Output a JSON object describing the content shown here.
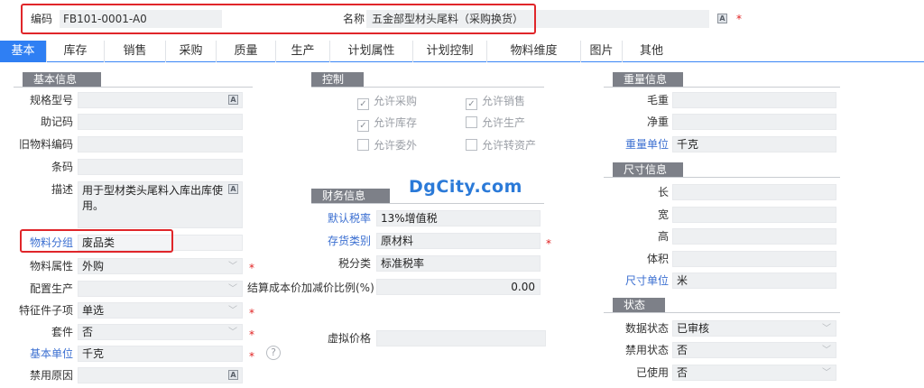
{
  "header": {
    "code_label": "编码",
    "code_value": "FB101-0001-A0",
    "name_label": "名称",
    "name_value": "五金部型材头尾料（采购换货）"
  },
  "tabs": [
    "基本",
    "库存",
    "销售",
    "采购",
    "质量",
    "生产",
    "计划属性",
    "计划控制",
    "物料维度",
    "图片",
    "其他"
  ],
  "basic": {
    "section_title": "基本信息",
    "spec_label": "规格型号",
    "mnemonic_label": "助记码",
    "old_code_label": "旧物料编码",
    "barcode_label": "条码",
    "desc_label": "描述",
    "desc_value": "用于型材类头尾料入库出库使用。",
    "group_label": "物料分组",
    "group_value": "废品类",
    "attr_label": "物料属性",
    "attr_value": "外购",
    "config_label": "配置生产",
    "feature_label": "特征件子项",
    "feature_value": "单选",
    "kit_label": "套件",
    "kit_value": "否",
    "unit_label": "基本单位",
    "unit_value": "千克",
    "disable_reason_label": "禁用原因"
  },
  "control": {
    "section_title": "控制",
    "items": [
      {
        "label": "允许采购",
        "checked": true
      },
      {
        "label": "允许销售",
        "checked": true
      },
      {
        "label": "允许库存",
        "checked": true
      },
      {
        "label": "允许生产",
        "checked": false
      },
      {
        "label": "允许委外",
        "checked": false
      },
      {
        "label": "允许转资产",
        "checked": false
      }
    ]
  },
  "finance": {
    "section_title": "财务信息",
    "tax_rate_label": "默认税率",
    "tax_rate_value": "13%增值税",
    "inventory_type_label": "存货类别",
    "inventory_type_value": "原材料",
    "tax_class_label": "税分类",
    "tax_class_value": "标准税率",
    "cost_ratio_label": "结算成本价加减价比例(%)",
    "cost_ratio_value": "0.00",
    "virtual_price_label": "虚拟价格"
  },
  "weight": {
    "section_title": "重量信息",
    "gross_label": "毛重",
    "net_label": "净重",
    "unit_label": "重量单位",
    "unit_value": "千克"
  },
  "size": {
    "section_title": "尺寸信息",
    "length_label": "长",
    "width_label": "宽",
    "height_label": "高",
    "volume_label": "体积",
    "unit_label": "尺寸单位",
    "unit_value": "米"
  },
  "status": {
    "section_title": "状态",
    "data_status_label": "数据状态",
    "data_status_value": "已审核",
    "disabled_status_label": "禁用状态",
    "disabled_status_value": "否",
    "used_label": "已使用",
    "used_value": "否"
  },
  "watermark": "DgCity.com",
  "icons": [
    "text-a-icon",
    "dropdown-arrow-icon",
    "help-icon",
    "checkbox-icon"
  ],
  "colors": {
    "tab_active": "#2f7ff3",
    "section_header": "#7d8088",
    "highlight_box": "#e0262a",
    "link": "#3b6fd1",
    "required": "#e02020"
  }
}
